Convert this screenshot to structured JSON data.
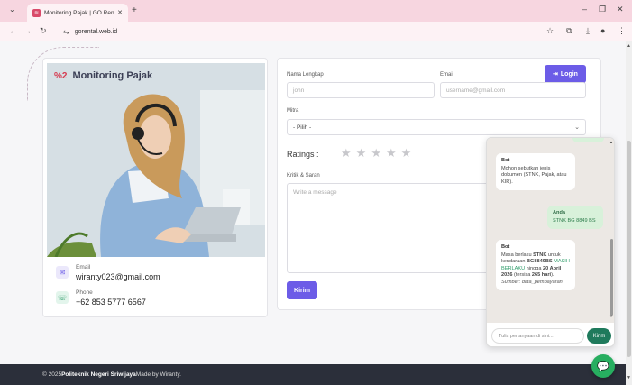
{
  "browser": {
    "tab_title": "Monitoring Pajak | GO Rental",
    "url": "gorental.web.id"
  },
  "photo_title": "Monitoring Pajak",
  "contact": {
    "email_label": "Email",
    "email_value": "wiranty023@gmail.com",
    "phone_label": "Phone",
    "phone_value": "+62 853 5777 6567"
  },
  "form": {
    "name_label": "Nama Lengkap",
    "name_placeholder": "john",
    "email_label": "Email",
    "email_placeholder": "username@gmail.com",
    "login_label": "Login",
    "mitra_label": "Mitra",
    "mitra_value": "- Pilih -",
    "ratings_label": "Ratings :",
    "rating_value": 0,
    "rating_max": 5,
    "kritik_label": "Kritik & Saran",
    "message_placeholder": "Write a message",
    "submit_label": "Kirim"
  },
  "chat": {
    "msg1_who": "Bot",
    "msg1_text": "Mohon sebutkan jenis dokumen (STNK, Pajak, atau KIR).",
    "msg2_who": "Anda",
    "msg2_text": "STNK BG 8849 BS",
    "msg3_who": "Bot",
    "msg3_pre": "Masa berlaku ",
    "msg3_doc": "STNK",
    "msg3_mid1": " untuk kendaraan ",
    "msg3_plate": "BG8849BS",
    "msg3_status": "MASIH BERLAKU",
    "msg3_mid2": " hingga ",
    "msg3_date": "20 April 2026",
    "msg3_mid3": " (tersisa ",
    "msg3_days": "265 hari",
    "msg3_end": ").",
    "msg3_source": "Sumber: data_pembayaran",
    "input_placeholder": "Tulis pertanyaan di sini...",
    "send_label": "Kirim"
  },
  "footer": {
    "prefix": "© 2025 ",
    "org": "Politeknik Negeri Sriwijaya",
    "suffix": " Made by Wiranty."
  },
  "colors": {
    "accent": "#6c5ce7",
    "chat_send": "#1f7a5c",
    "fab": "#27ae60",
    "footer_bg": "#2b2f3a"
  }
}
